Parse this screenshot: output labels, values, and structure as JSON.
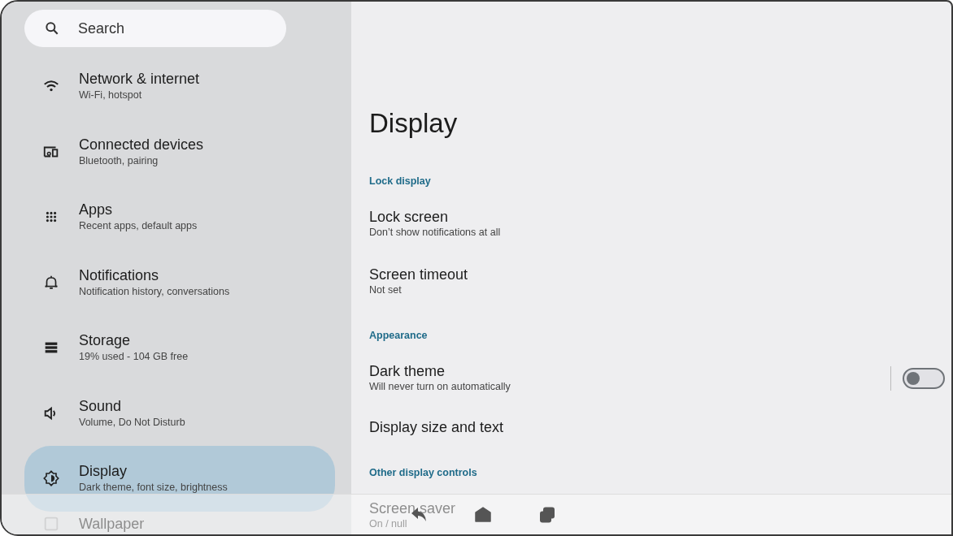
{
  "search": {
    "placeholder": "Search"
  },
  "sidebar": {
    "items": [
      {
        "title": "Network & internet",
        "subtitle": "Wi-Fi, hotspot",
        "selected": false
      },
      {
        "title": "Connected devices",
        "subtitle": "Bluetooth, pairing",
        "selected": false
      },
      {
        "title": "Apps",
        "subtitle": "Recent apps, default apps",
        "selected": false
      },
      {
        "title": "Notifications",
        "subtitle": "Notification history, conversations",
        "selected": false
      },
      {
        "title": "Storage",
        "subtitle": "19% used - 104 GB free",
        "selected": false
      },
      {
        "title": "Sound",
        "subtitle": "Volume, Do Not Disturb",
        "selected": false
      },
      {
        "title": "Display",
        "subtitle": "Dark theme, font size, brightness",
        "selected": true
      },
      {
        "title": "Wallpaper",
        "selected": false
      }
    ]
  },
  "page_title": "Display",
  "sections": [
    {
      "header": "Lock display",
      "items": [
        {
          "title": "Lock screen",
          "subtitle": "Don’t show notifications at all"
        },
        {
          "title": "Screen timeout",
          "subtitle": "Not set"
        }
      ]
    },
    {
      "header": "Appearance",
      "items": [
        {
          "title": "Dark theme",
          "subtitle": "Will never turn on automatically",
          "toggle": {
            "on": false
          }
        },
        {
          "title": "Display size and text"
        }
      ]
    },
    {
      "header": "Other display controls",
      "items": [
        {
          "title": "Screen saver",
          "subtitle": "On / null"
        }
      ]
    }
  ]
}
